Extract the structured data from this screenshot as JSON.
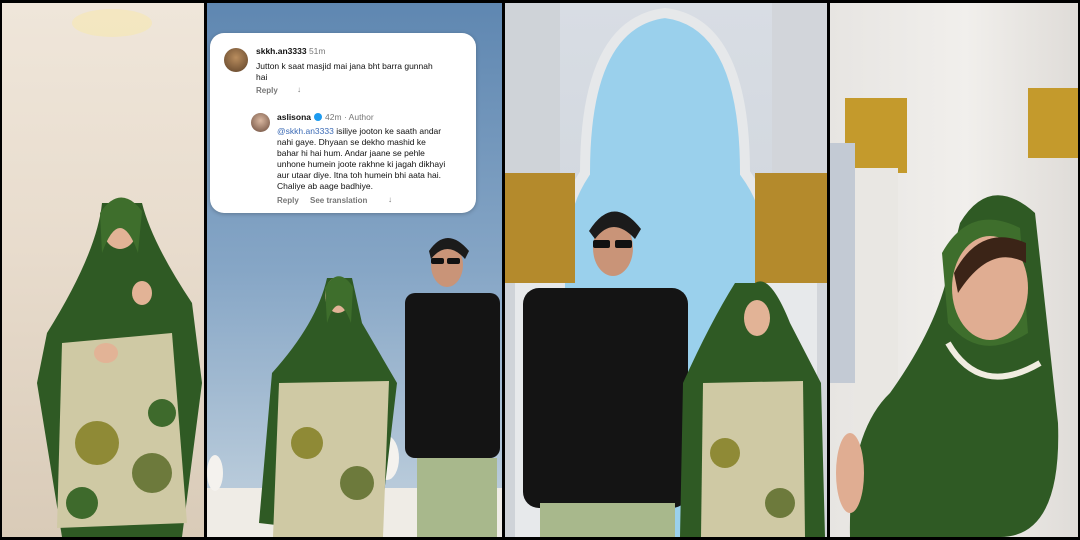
{
  "comment": {
    "username": "skkh.an3333",
    "time": "51m",
    "text_line1": "Jutton k saat masjid mai jana bht barra gunnah",
    "text_line2": "hai",
    "reply_label": "Reply",
    "arrow": "↓"
  },
  "reply": {
    "username": "aslisona",
    "time": "42m",
    "author_label": "Author",
    "mention": "@skkh.an3333",
    "line1": " isiliye jooton ke saath andar",
    "line2": "nahi gaye. Dhyaan se dekho mashid ke",
    "line3": "bahar hi hai hum. Andar jaane se pehle",
    "line4": "unhone humein joote rakhne ki jagah dikhayi",
    "line5": "aur utaar diye. Itna toh humein bhi aata hai.",
    "line6": "Chaliye ab aage badhiye.",
    "reply_label": "Reply",
    "translate_label": "See translation",
    "arrow": "↓"
  },
  "colors": {
    "dupatta_green": "#2f5a24",
    "accent_blue": "#3b6ab5",
    "verified": "#1d9bf0"
  }
}
